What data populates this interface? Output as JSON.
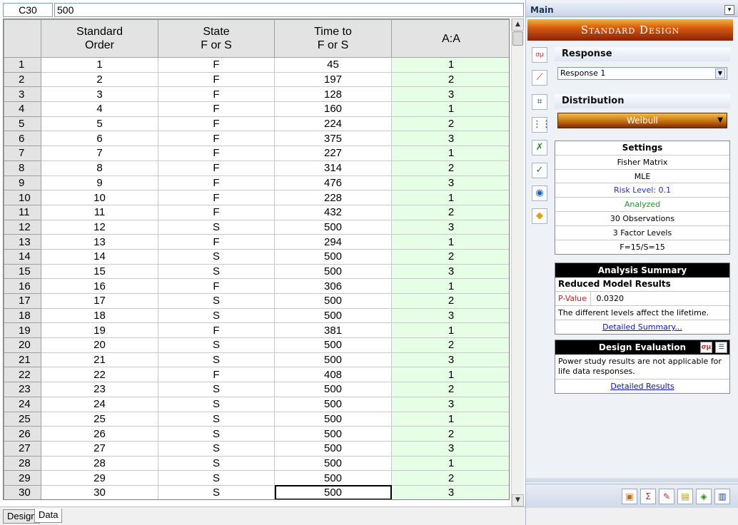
{
  "formula_bar": {
    "cell_ref": "C30",
    "value": "500"
  },
  "grid": {
    "columns": [
      {
        "line1": "Standard",
        "line2": "Order"
      },
      {
        "line1": "State",
        "line2": "F or S"
      },
      {
        "line1": "Time to",
        "line2": "F or S"
      },
      {
        "line1": "A:A",
        "line2": ""
      }
    ],
    "rows": [
      [
        "1",
        "1",
        "F",
        "45",
        "1"
      ],
      [
        "2",
        "2",
        "F",
        "197",
        "2"
      ],
      [
        "3",
        "3",
        "F",
        "128",
        "3"
      ],
      [
        "4",
        "4",
        "F",
        "160",
        "1"
      ],
      [
        "5",
        "5",
        "F",
        "224",
        "2"
      ],
      [
        "6",
        "6",
        "F",
        "375",
        "3"
      ],
      [
        "7",
        "7",
        "F",
        "227",
        "1"
      ],
      [
        "8",
        "8",
        "F",
        "314",
        "2"
      ],
      [
        "9",
        "9",
        "F",
        "476",
        "3"
      ],
      [
        "10",
        "10",
        "F",
        "228",
        "1"
      ],
      [
        "11",
        "11",
        "F",
        "432",
        "2"
      ],
      [
        "12",
        "12",
        "S",
        "500",
        "3"
      ],
      [
        "13",
        "13",
        "F",
        "294",
        "1"
      ],
      [
        "14",
        "14",
        "S",
        "500",
        "2"
      ],
      [
        "15",
        "15",
        "S",
        "500",
        "3"
      ],
      [
        "16",
        "16",
        "F",
        "306",
        "1"
      ],
      [
        "17",
        "17",
        "S",
        "500",
        "2"
      ],
      [
        "18",
        "18",
        "S",
        "500",
        "3"
      ],
      [
        "19",
        "19",
        "F",
        "381",
        "1"
      ],
      [
        "20",
        "20",
        "S",
        "500",
        "2"
      ],
      [
        "21",
        "21",
        "S",
        "500",
        "3"
      ],
      [
        "22",
        "22",
        "F",
        "408",
        "1"
      ],
      [
        "23",
        "23",
        "S",
        "500",
        "2"
      ],
      [
        "24",
        "24",
        "S",
        "500",
        "3"
      ],
      [
        "25",
        "25",
        "S",
        "500",
        "1"
      ],
      [
        "26",
        "26",
        "S",
        "500",
        "2"
      ],
      [
        "27",
        "27",
        "S",
        "500",
        "3"
      ],
      [
        "28",
        "28",
        "S",
        "500",
        "1"
      ],
      [
        "29",
        "29",
        "S",
        "500",
        "2"
      ],
      [
        "30",
        "30",
        "S",
        "500",
        "3"
      ]
    ]
  },
  "tabs": {
    "design": "Design",
    "data": "Data"
  },
  "panel": {
    "title": "Main",
    "banner": "Standard Design",
    "response_label": "Response",
    "response_value": "Response 1",
    "distribution_label": "Distribution",
    "distribution_value": "Weibull",
    "settings": {
      "title": "Settings",
      "method": "Fisher Matrix",
      "estimation": "MLE",
      "risk": "Risk Level: 0.1",
      "status": "Analyzed",
      "observations": "30 Observations",
      "levels": "3 Factor Levels",
      "counts": "F=15/S=15"
    },
    "analysis": {
      "title": "Analysis Summary",
      "subtitle": "Reduced Model Results",
      "pvalue_label": "P-Value",
      "pvalue": "0.0320",
      "conclusion": "The different levels affect the lifetime.",
      "link": "Detailed Summary..."
    },
    "design_eval": {
      "title": "Design Evaluation",
      "message": "Power study results are not applicable for life data responses.",
      "link": "Detailed Results"
    }
  },
  "icons": [
    "sigma-mu-icon",
    "plot-icon",
    "profile-plot-icon",
    "matrix-icon",
    "model-icon",
    "checklist-icon",
    "info-icon",
    "yellow-diamond-icon"
  ],
  "colors": {
    "factor_column": "#e6fde6",
    "banner": "#d65a10",
    "risk_text": "#1f2fd0",
    "analyzed_text": "#1a9a2a",
    "pvalue_label": "#d42020"
  }
}
